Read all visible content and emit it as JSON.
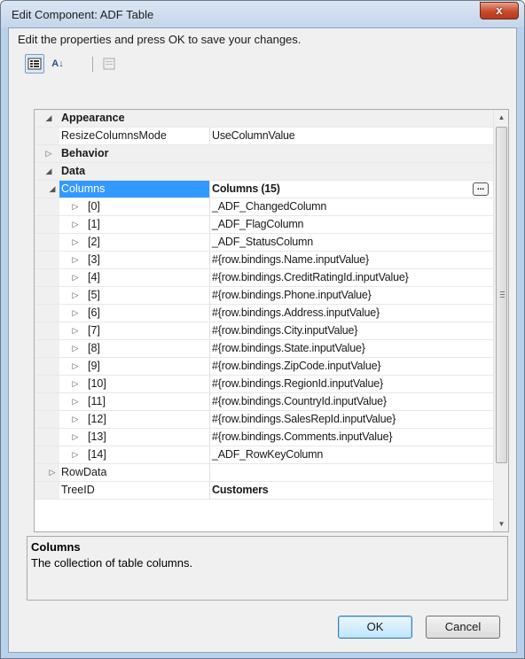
{
  "window": {
    "title": "Edit Component: ADF Table",
    "close_label": "x"
  },
  "instructions": "Edit the properties and press OK to save your changes.",
  "toolbar": {
    "categorized": "categorized-icon",
    "alphabetical_label": "A↓",
    "pages": "property-pages-icon"
  },
  "grid": {
    "categories": {
      "appearance": "Appearance",
      "behavior": "Behavior",
      "data": "Data"
    },
    "appearance_rows": [
      {
        "name": "ResizeColumnsMode",
        "value": "UseColumnValue"
      }
    ],
    "columns": {
      "name": "Columns",
      "value": "Columns (15)",
      "button": "..."
    },
    "column_items": [
      {
        "name": "[0]",
        "value": "_ADF_ChangedColumn"
      },
      {
        "name": "[1]",
        "value": "_ADF_FlagColumn"
      },
      {
        "name": "[2]",
        "value": "_ADF_StatusColumn"
      },
      {
        "name": "[3]",
        "value": "#{row.bindings.Name.inputValue}"
      },
      {
        "name": "[4]",
        "value": "#{row.bindings.CreditRatingId.inputValue}"
      },
      {
        "name": "[5]",
        "value": "#{row.bindings.Phone.inputValue}"
      },
      {
        "name": "[6]",
        "value": "#{row.bindings.Address.inputValue}"
      },
      {
        "name": "[7]",
        "value": "#{row.bindings.City.inputValue}"
      },
      {
        "name": "[8]",
        "value": "#{row.bindings.State.inputValue}"
      },
      {
        "name": "[9]",
        "value": "#{row.bindings.ZipCode.inputValue}"
      },
      {
        "name": "[10]",
        "value": "#{row.bindings.RegionId.inputValue}"
      },
      {
        "name": "[11]",
        "value": "#{row.bindings.CountryId.inputValue}"
      },
      {
        "name": "[12]",
        "value": "#{row.bindings.SalesRepId.inputValue}"
      },
      {
        "name": "[13]",
        "value": "#{row.bindings.Comments.inputValue}"
      },
      {
        "name": "[14]",
        "value": "_ADF_RowKeyColumn"
      }
    ],
    "rowdata": {
      "name": "RowData",
      "value": ""
    },
    "treeid": {
      "name": "TreeID",
      "value": "Customers"
    }
  },
  "description": {
    "title": "Columns",
    "text": "The collection of table columns."
  },
  "buttons": {
    "ok": "OK",
    "cancel": "Cancel"
  },
  "colors": {
    "selection": "#3399ff",
    "close": "#c74a2c"
  }
}
